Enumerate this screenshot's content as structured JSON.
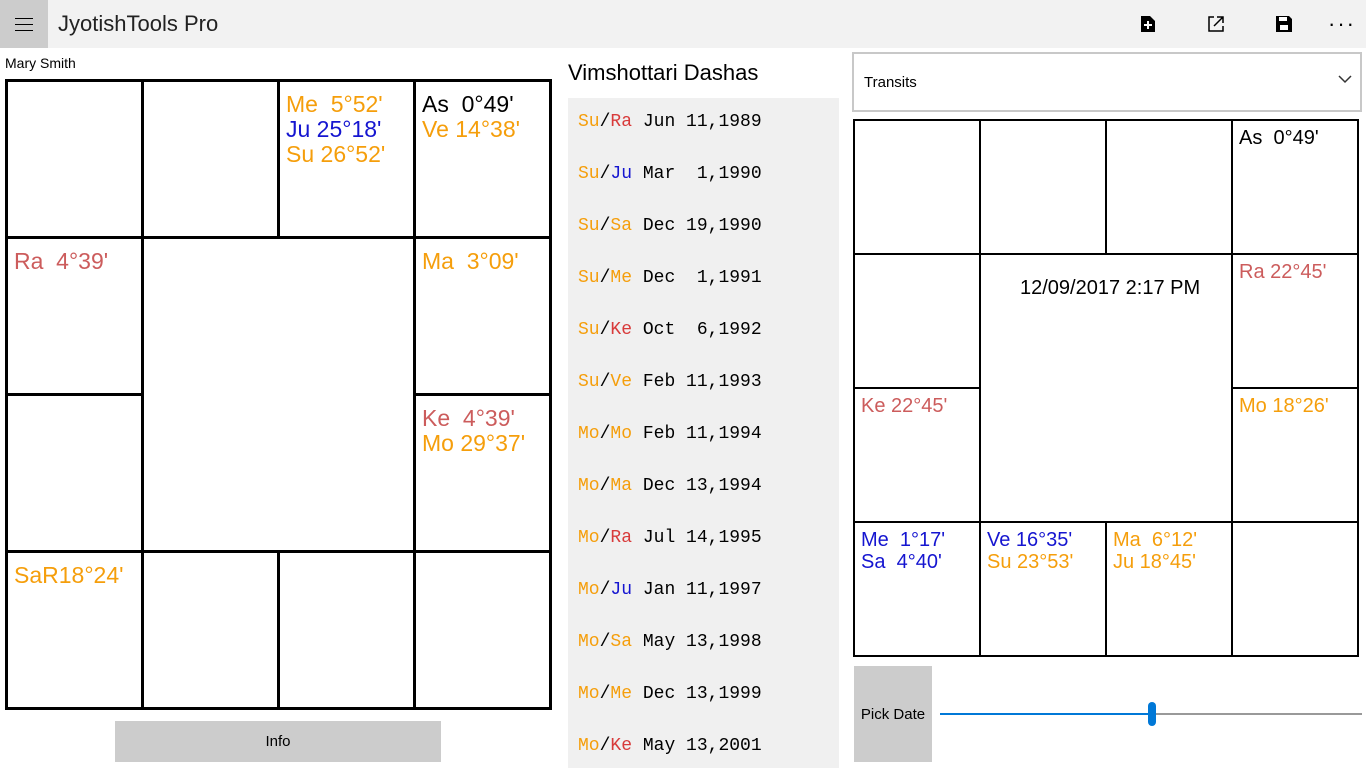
{
  "app": {
    "title": "JyotishTools Pro"
  },
  "toolbar": {
    "new_icon": "new-file-icon",
    "share_icon": "open-external-icon",
    "save_icon": "save-icon",
    "more_label": "···"
  },
  "person": {
    "name": "Mary Smith"
  },
  "colors": {
    "orange": "#f59e0b",
    "blue": "#1515d0",
    "red": "#d83a3a",
    "salmon": "#cc5c5c",
    "black": "#000000",
    "accent": "#0078d7"
  },
  "natal": {
    "cells": [
      {
        "id": "r0c2",
        "lines": [
          {
            "text": "Me  5°52'",
            "color": "#f59e0b"
          },
          {
            "text": "Ju 25°18'",
            "color": "#1515d0"
          },
          {
            "text": "Su 26°52'",
            "color": "#f59e0b"
          }
        ]
      },
      {
        "id": "r0c3",
        "lines": [
          {
            "text": "As  0°49'",
            "color": "#000000"
          },
          {
            "text": "Ve 14°38'",
            "color": "#f59e0b"
          }
        ]
      },
      {
        "id": "r1c0",
        "lines": [
          {
            "text": "Ra  4°39'",
            "color": "#cc5c5c"
          }
        ]
      },
      {
        "id": "r1c3",
        "lines": [
          {
            "text": "Ma  3°09'",
            "color": "#f59e0b"
          }
        ]
      },
      {
        "id": "r2c3",
        "lines": [
          {
            "text": "Ke  4°39'",
            "color": "#cc5c5c"
          },
          {
            "text": "Mo 29°37'",
            "color": "#f59e0b"
          }
        ]
      },
      {
        "id": "r3c0",
        "lines": [
          {
            "text": "SaR18°24'",
            "color": "#f59e0b"
          }
        ]
      }
    ]
  },
  "info_button": {
    "label": "Info"
  },
  "dashas": {
    "title": "Vimshottari Dashas",
    "rows": [
      {
        "maha": "Su",
        "maha_color": "#f59e0b",
        "antar": "Ra",
        "antar_color": "#d83a3a",
        "date": "Jun 11,1989"
      },
      {
        "maha": "Su",
        "maha_color": "#f59e0b",
        "antar": "Ju",
        "antar_color": "#1515d0",
        "date": "Mar  1,1990"
      },
      {
        "maha": "Su",
        "maha_color": "#f59e0b",
        "antar": "Sa",
        "antar_color": "#f59e0b",
        "date": "Dec 19,1990"
      },
      {
        "maha": "Su",
        "maha_color": "#f59e0b",
        "antar": "Me",
        "antar_color": "#f59e0b",
        "date": "Dec  1,1991"
      },
      {
        "maha": "Su",
        "maha_color": "#f59e0b",
        "antar": "Ke",
        "antar_color": "#d83a3a",
        "date": "Oct  6,1992"
      },
      {
        "maha": "Su",
        "maha_color": "#f59e0b",
        "antar": "Ve",
        "antar_color": "#f59e0b",
        "date": "Feb 11,1993"
      },
      {
        "maha": "Mo",
        "maha_color": "#f59e0b",
        "antar": "Mo",
        "antar_color": "#f59e0b",
        "date": "Feb 11,1994"
      },
      {
        "maha": "Mo",
        "maha_color": "#f59e0b",
        "antar": "Ma",
        "antar_color": "#f59e0b",
        "date": "Dec 13,1994"
      },
      {
        "maha": "Mo",
        "maha_color": "#f59e0b",
        "antar": "Ra",
        "antar_color": "#d83a3a",
        "date": "Jul 14,1995"
      },
      {
        "maha": "Mo",
        "maha_color": "#f59e0b",
        "antar": "Ju",
        "antar_color": "#1515d0",
        "date": "Jan 11,1997"
      },
      {
        "maha": "Mo",
        "maha_color": "#f59e0b",
        "antar": "Sa",
        "antar_color": "#f59e0b",
        "date": "May 13,1998"
      },
      {
        "maha": "Mo",
        "maha_color": "#f59e0b",
        "antar": "Me",
        "antar_color": "#f59e0b",
        "date": "Dec 13,1999"
      },
      {
        "maha": "Mo",
        "maha_color": "#f59e0b",
        "antar": "Ke",
        "antar_color": "#d83a3a",
        "date": "May 13,2001"
      }
    ]
  },
  "transits": {
    "dropdown_value": "Transits",
    "datetime": "12/09/2017 2:17 PM",
    "cells": [
      {
        "id": "r0c3",
        "lines": [
          {
            "text": "As  0°49'",
            "color": "#000000"
          }
        ]
      },
      {
        "id": "r1c3",
        "lines": [
          {
            "text": "Ra 22°45'",
            "color": "#cc5c5c"
          }
        ]
      },
      {
        "id": "r2c0",
        "lines": [
          {
            "text": "Ke 22°45'",
            "color": "#cc5c5c"
          }
        ]
      },
      {
        "id": "r2c3",
        "lines": [
          {
            "text": "Mo 18°26'",
            "color": "#f59e0b"
          }
        ]
      },
      {
        "id": "r3c0",
        "lines": [
          {
            "text": "Me  1°17'",
            "color": "#1515d0"
          },
          {
            "text": "Sa  4°40'",
            "color": "#1515d0"
          }
        ]
      },
      {
        "id": "r3c1",
        "lines": [
          {
            "text": "Ve 16°35'",
            "color": "#1515d0"
          },
          {
            "text": "Su 23°53'",
            "color": "#f59e0b"
          }
        ]
      },
      {
        "id": "r3c2",
        "lines": [
          {
            "text": "Ma  6°12'",
            "color": "#f59e0b"
          },
          {
            "text": "Ju 18°45'",
            "color": "#f59e0b"
          }
        ]
      }
    ]
  },
  "pick_date": {
    "label": "Pick Date"
  },
  "slider": {
    "fraction": 0.502
  }
}
